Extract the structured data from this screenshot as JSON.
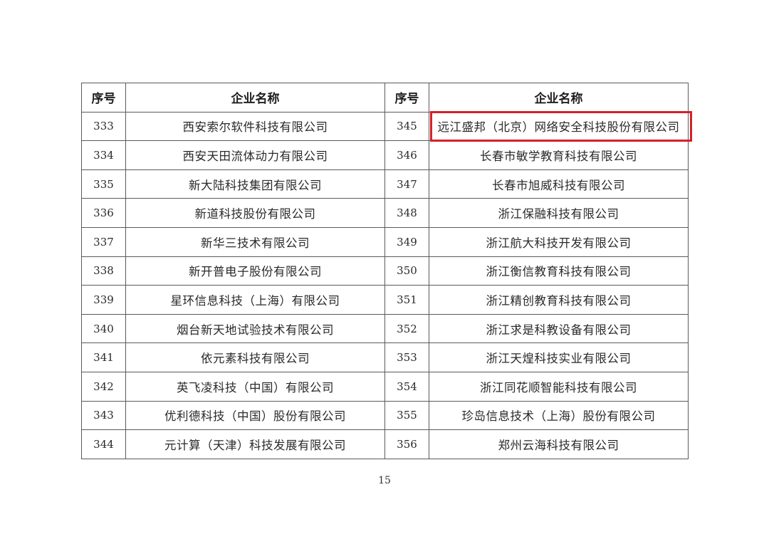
{
  "table": {
    "headers": [
      "序号",
      "企业名称",
      "序号",
      "企业名称"
    ],
    "rows": [
      {
        "left_no": "333",
        "left_name": "西安索尔软件科技有限公司",
        "right_no": "345",
        "right_name": "远江盛邦（北京）网络安全科技股份有限公司"
      },
      {
        "left_no": "334",
        "left_name": "西安天田流体动力有限公司",
        "right_no": "346",
        "right_name": "长春市敏学教育科技有限公司"
      },
      {
        "left_no": "335",
        "left_name": "新大陆科技集团有限公司",
        "right_no": "347",
        "right_name": "长春市旭威科技有限公司"
      },
      {
        "left_no": "336",
        "left_name": "新道科技股份有限公司",
        "right_no": "348",
        "right_name": "浙江保融科技有限公司"
      },
      {
        "left_no": "337",
        "left_name": "新华三技术有限公司",
        "right_no": "349",
        "right_name": "浙江航大科技开发有限公司"
      },
      {
        "left_no": "338",
        "left_name": "新开普电子股份有限公司",
        "right_no": "350",
        "right_name": "浙江衡信教育科技有限公司"
      },
      {
        "left_no": "339",
        "left_name": "星环信息科技（上海）有限公司",
        "right_no": "351",
        "right_name": "浙江精创教育科技有限公司"
      },
      {
        "left_no": "340",
        "left_name": "烟台新天地试验技术有限公司",
        "right_no": "352",
        "right_name": "浙江求是科教设备有限公司"
      },
      {
        "left_no": "341",
        "left_name": "依元素科技有限公司",
        "right_no": "353",
        "right_name": "浙江天煌科技实业有限公司"
      },
      {
        "left_no": "342",
        "left_name": "英飞凌科技（中国）有限公司",
        "right_no": "354",
        "right_name": "浙江同花顺智能科技有限公司"
      },
      {
        "left_no": "343",
        "left_name": "优利德科技（中国）股份有限公司",
        "right_no": "355",
        "right_name": "珍岛信息技术（上海）股份有限公司"
      },
      {
        "left_no": "344",
        "left_name": "元计算（天津）科技发展有限公司",
        "right_no": "356",
        "right_name": "郑州云海科技有限公司"
      }
    ]
  },
  "highlight": {
    "color": "#d6202a",
    "target": "345"
  },
  "page_number": "15"
}
